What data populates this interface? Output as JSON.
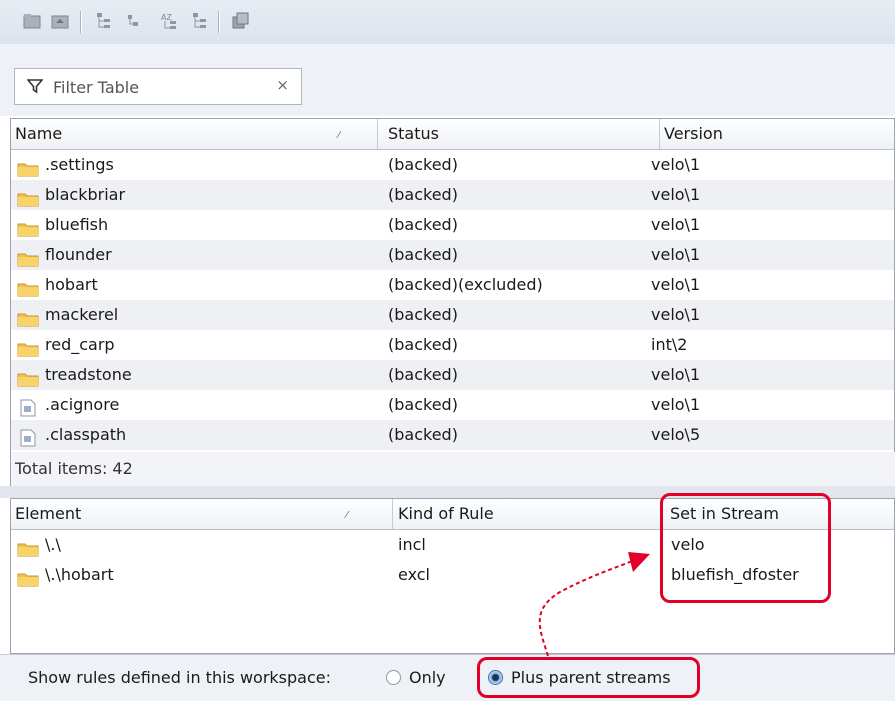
{
  "toolbar": {
    "buttons": [
      {
        "name": "toolbar-button-1",
        "icon": "folder-grey-icon"
      },
      {
        "name": "toolbar-button-2",
        "icon": "folder-up-icon"
      },
      {
        "name": "toolbar-button-3",
        "icon": "tree-expand-icon"
      },
      {
        "name": "toolbar-button-4",
        "icon": "tree-node-icon"
      },
      {
        "name": "toolbar-button-5",
        "icon": "sort-tree-icon"
      },
      {
        "name": "toolbar-button-6",
        "icon": "tree-collapse-icon"
      },
      {
        "name": "toolbar-button-7",
        "icon": "window-icon"
      }
    ]
  },
  "filter": {
    "placeholder": "Filter Table",
    "clear_glyph": "×"
  },
  "files_table": {
    "columns": {
      "name": "Name",
      "status": "Status",
      "version": "Version"
    },
    "rows": [
      {
        "name": ".settings",
        "status": "(backed)",
        "version": "velo\\1",
        "icon": "folder-icon"
      },
      {
        "name": "blackbriar",
        "status": "(backed)",
        "version": "velo\\1",
        "icon": "folder-icon"
      },
      {
        "name": "bluefish",
        "status": "(backed)",
        "version": "velo\\1",
        "icon": "folder-icon"
      },
      {
        "name": "flounder",
        "status": "(backed)",
        "version": "velo\\1",
        "icon": "folder-icon"
      },
      {
        "name": "hobart",
        "status": "(backed)(excluded)",
        "version": "velo\\1",
        "icon": "folder-icon"
      },
      {
        "name": "mackerel",
        "status": "(backed)",
        "version": "velo\\1",
        "icon": "folder-icon"
      },
      {
        "name": "red_carp",
        "status": "(backed)",
        "version": "int\\2",
        "icon": "folder-icon"
      },
      {
        "name": "treadstone",
        "status": "(backed)",
        "version": "velo\\1",
        "icon": "folder-icon"
      },
      {
        "name": ".acignore",
        "status": "(backed)",
        "version": "velo\\1",
        "icon": "file-icon"
      },
      {
        "name": ".classpath",
        "status": "(backed)",
        "version": "velo\\5",
        "icon": "file-icon"
      }
    ],
    "total_text": "Total items: 42"
  },
  "rules_table": {
    "columns": {
      "element": "Element",
      "kind": "Kind of Rule",
      "stream": "Set in Stream"
    },
    "rows": [
      {
        "element": "\\.\\",
        "kind": "incl",
        "stream": "velo",
        "icon": "folder-icon"
      },
      {
        "element": "\\.\\hobart",
        "kind": "excl",
        "stream": "bluefish_dfoster",
        "icon": "folder-icon"
      }
    ]
  },
  "rules_filter": {
    "label": "Show rules defined in this workspace:",
    "options": [
      {
        "label": "Only",
        "selected": false
      },
      {
        "label": "Plus parent streams",
        "selected": true
      }
    ]
  },
  "annotations": {
    "highlight_color": "#e2002a"
  }
}
